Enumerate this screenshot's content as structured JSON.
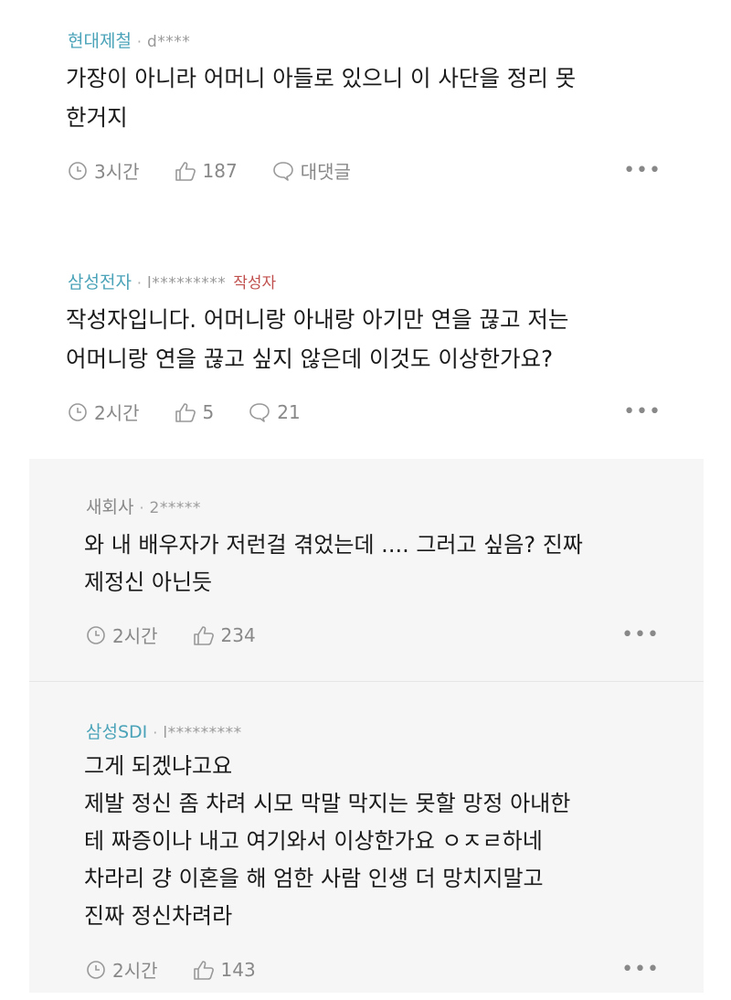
{
  "comments": [
    {
      "company": "현대제철",
      "user": "d****",
      "badge": "",
      "text_lines": [
        "가장이 아니라 어머니 아들로 있으니 이 사단을 정리 못",
        "한거지"
      ],
      "time": "3시간",
      "likes": "187",
      "reply_label": "대댓글",
      "more": "•••"
    },
    {
      "company": "삼성전자",
      "user": "l*********",
      "badge": "작성자",
      "text_lines": [
        "작성자입니다. 어머니랑 아내랑 아기만 연을 끊고 저는",
        "어머니랑 연을 끊고 싶지 않은데 이것도 이상한가요?"
      ],
      "time": "2시간",
      "likes": "5",
      "replies": "21",
      "more": "•••"
    },
    {
      "company": "새회사",
      "user": "2*****",
      "text_lines": [
        "와 내 배우자가 저런걸 겪었는데 .... 그러고 싶음? 진짜",
        "제정신 아닌듯"
      ],
      "time": "2시간",
      "likes": "234",
      "more": "•••"
    },
    {
      "company": "삼성SDI",
      "user": "l*********",
      "text_lines": [
        "그게 되겠냐고요",
        "제발 정신 좀 차려 시모 막말 막지는 못할 망정 아내한",
        "테 짜증이나 내고 여기와서 이상한가요 ㅇㅈㄹ하네",
        "차라리 걍 이혼을 해 엄한 사람 인생 더 망치지말고",
        "진짜 정신차려라"
      ],
      "time": "2시간",
      "likes": "143",
      "more": "•••"
    }
  ],
  "icons": {
    "clock": "clock-icon",
    "like": "thumbs-up-icon",
    "reply": "speech-bubble-icon",
    "more": "more-icon"
  },
  "colors": {
    "company": "#4aa3b8",
    "author_badge": "#c0504d",
    "meta_gray": "#888888",
    "reply_bg": "#f6f6f6"
  }
}
